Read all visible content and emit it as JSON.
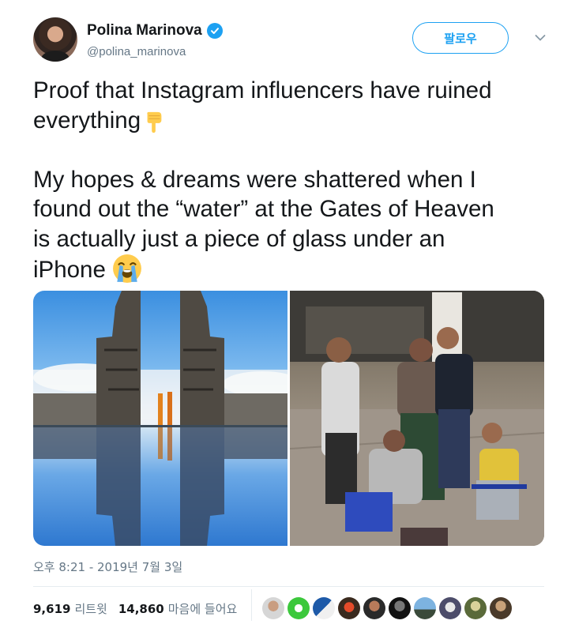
{
  "author": {
    "name": "Polina Marinova",
    "handle": "@polina_marinova",
    "verified": true
  },
  "follow_button": "팔로우",
  "tweet": {
    "line1": "Proof that Instagram influencers have ruined",
    "line2": "everything",
    "para2": "My hopes & dreams were shattered when I\nfound out the “water” at the Gates of Heaven\nis actually just a piece of glass under an\niPhone",
    "emoji1": "pointing-down-emoji",
    "emoji2": "loudly-crying-face-emoji"
  },
  "media": [
    {
      "name": "photo-gates-of-heaven-reflection"
    },
    {
      "name": "photo-tourists-with-glass-and-phone"
    }
  ],
  "timestamp": "오후 8:21 - 2019년 7월 3일",
  "stats": {
    "retweets_count": "9,619",
    "retweets_label": "리트윗",
    "likes_count": "14,860",
    "likes_label": "마음에 들어요"
  },
  "colors": {
    "accent": "#1da1f2",
    "text": "#14171a",
    "muted": "#657786",
    "divider": "#e6ecf0"
  },
  "icons": [
    "verified-badge-icon",
    "chevron-down-icon"
  ]
}
